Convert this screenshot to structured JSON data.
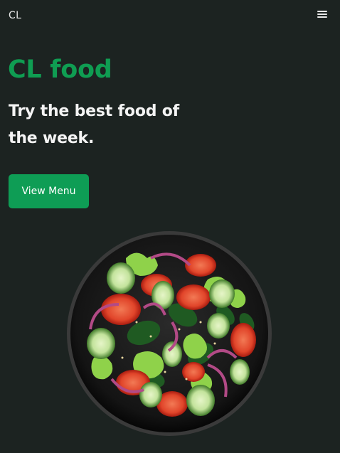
{
  "header": {
    "logo": "CL",
    "menu_icon": "hamburger-menu-icon"
  },
  "hero": {
    "title": "CL food",
    "tagline": "Try the best food of the week.",
    "cta_label": "View Menu",
    "image_alt": "Salad bowl with tomatoes, cucumbers, spinach, lettuce and red onion"
  },
  "colors": {
    "background": "#1c2321",
    "accent": "#0f9d52",
    "button": "#0e9d55"
  }
}
